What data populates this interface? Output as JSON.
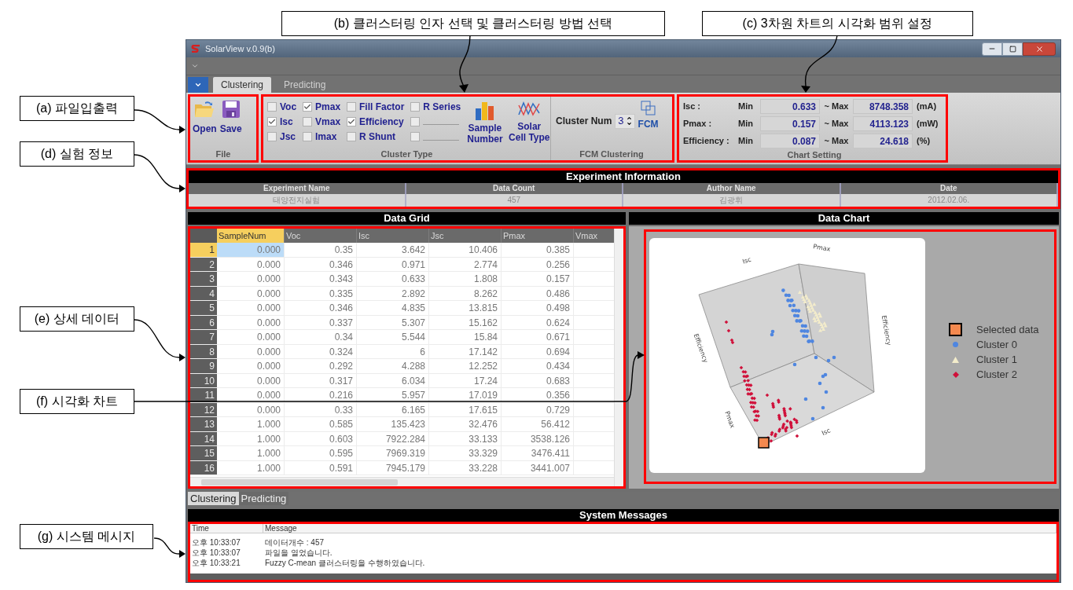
{
  "callouts": [
    {
      "label": "(a) 파일입출력"
    },
    {
      "label": "(d) 실험 정보"
    },
    {
      "label": "(e) 상세 데이터"
    },
    {
      "label": "(f) 시각화 차트"
    },
    {
      "label": "(g) 시스템 메시지"
    },
    {
      "label": "(b) 클러스터링 인자 선택 및 클러스터링 방법 선택"
    },
    {
      "label": "(c) 3차원 차트의 시각화 범위 설정"
    }
  ],
  "window": {
    "title": "SolarView v.0.9(b)"
  },
  "tabs": [
    {
      "label": "Clustering",
      "selected": true
    },
    {
      "label": "Predicting",
      "selected": false
    }
  ],
  "ribbon": {
    "file": {
      "buttons": [
        {
          "label": "Open",
          "kind": "open"
        },
        {
          "label": "Save",
          "kind": "save"
        }
      ],
      "group_label": "File"
    },
    "cluster_type": {
      "checkboxes": [
        {
          "kind": "labeled",
          "label": "Voc",
          "checked": false
        },
        {
          "kind": "labeled",
          "label": "Isc",
          "checked": true
        },
        {
          "kind": "labeled",
          "label": "Jsc",
          "checked": false
        },
        {
          "kind": "labeled",
          "label": "Pmax",
          "checked": true
        },
        {
          "kind": "labeled",
          "label": "Vmax",
          "checked": false
        },
        {
          "kind": "labeled",
          "label": "Imax",
          "checked": false
        },
        {
          "kind": "labeled",
          "label": "Fill Factor",
          "checked": false
        },
        {
          "kind": "labeled",
          "label": "Efficiency",
          "checked": true
        },
        {
          "kind": "labeled",
          "label": "R Shunt",
          "checked": false
        },
        {
          "kind": "labeled",
          "label": "R Series",
          "checked": false
        },
        {
          "kind": "blank",
          "checked": false
        },
        {
          "kind": "blank",
          "checked": false
        }
      ],
      "buttons": [
        {
          "label": "Sample Number",
          "kind": "bars"
        },
        {
          "label": "Solar Cell Type",
          "kind": "lines"
        }
      ],
      "group_label": "Cluster Type"
    },
    "fcm": {
      "label": "Cluster Num",
      "value": "3",
      "button": "FCM",
      "group_label": "FCM Clustering"
    },
    "chart_setting": {
      "rows": [
        {
          "label": "Isc :",
          "min_label": "Min",
          "min": "0.633",
          "max_label": "~ Max",
          "max": "8748.358",
          "unit": "(mA)"
        },
        {
          "label": "Pmax :",
          "min_label": "Min",
          "min": "0.157",
          "max_label": "~ Max",
          "max": "4113.123",
          "unit": "(mW)"
        },
        {
          "label": "Efficiency :",
          "min_label": "Min",
          "min": "0.087",
          "max_label": "~ Max",
          "max": "24.618",
          "unit": "(%)"
        }
      ],
      "group_label": "Chart Setting"
    }
  },
  "experiment": {
    "title": "Experiment Information",
    "columns": [
      "Experiment Name",
      "Data Count",
      "Author Name",
      "Date"
    ],
    "values": [
      "태양전지실험",
      "457",
      "김광휘",
      "2012.02.06."
    ]
  },
  "data_grid": {
    "title": "Data Grid",
    "columns": [
      "SampleNum",
      "Voc",
      "Isc",
      "Jsc",
      "Pmax",
      "Vmax"
    ],
    "rows": [
      {
        "number": "1",
        "selected": true,
        "cells": [
          "0.000",
          "0.35",
          "3.642",
          "10.406",
          "0.385"
        ]
      },
      {
        "number": "2",
        "selected": false,
        "cells": [
          "0.000",
          "0.346",
          "0.971",
          "2.774",
          "0.256"
        ]
      },
      {
        "number": "3",
        "selected": false,
        "cells": [
          "0.000",
          "0.343",
          "0.633",
          "1.808",
          "0.157"
        ]
      },
      {
        "number": "4",
        "selected": false,
        "cells": [
          "0.000",
          "0.335",
          "2.892",
          "8.262",
          "0.486"
        ]
      },
      {
        "number": "5",
        "selected": false,
        "cells": [
          "0.000",
          "0.346",
          "4.835",
          "13.815",
          "0.498"
        ]
      },
      {
        "number": "6",
        "selected": false,
        "cells": [
          "0.000",
          "0.337",
          "5.307",
          "15.162",
          "0.624"
        ]
      },
      {
        "number": "7",
        "selected": false,
        "cells": [
          "0.000",
          "0.34",
          "5.544",
          "15.84",
          "0.671"
        ]
      },
      {
        "number": "8",
        "selected": false,
        "cells": [
          "0.000",
          "0.324",
          "6",
          "17.142",
          "0.694"
        ]
      },
      {
        "number": "9",
        "selected": false,
        "cells": [
          "0.000",
          "0.292",
          "4.288",
          "12.252",
          "0.434"
        ]
      },
      {
        "number": "10",
        "selected": false,
        "cells": [
          "0.000",
          "0.317",
          "6.034",
          "17.24",
          "0.683"
        ]
      },
      {
        "number": "11",
        "selected": false,
        "cells": [
          "0.000",
          "0.216",
          "5.957",
          "17.019",
          "0.356"
        ]
      },
      {
        "number": "12",
        "selected": false,
        "cells": [
          "0.000",
          "0.33",
          "6.165",
          "17.615",
          "0.729"
        ]
      },
      {
        "number": "13",
        "selected": false,
        "cells": [
          "1.000",
          "0.585",
          "135.423",
          "32.476",
          "56.412"
        ]
      },
      {
        "number": "14",
        "selected": false,
        "cells": [
          "1.000",
          "0.603",
          "7922.284",
          "33.133",
          "3538.126"
        ]
      },
      {
        "number": "15",
        "selected": false,
        "cells": [
          "1.000",
          "0.595",
          "7969.319",
          "33.329",
          "3476.411"
        ]
      },
      {
        "number": "16",
        "selected": false,
        "cells": [
          "1.000",
          "0.591",
          "7945.179",
          "33.228",
          "3441.007"
        ]
      }
    ]
  },
  "data_chart": {
    "title": "Data Chart",
    "axis_labels": [
      "Isc",
      "Pmax",
      "Efficiency",
      "Efficiency",
      "Pmax",
      "Isc"
    ],
    "legend": [
      {
        "label": "Selected data",
        "kind": "square",
        "color": "#f4894f"
      },
      {
        "label": "Cluster 0",
        "kind": "circle",
        "color": "#4f86e0"
      },
      {
        "label": "Cluster 1",
        "kind": "triangle",
        "color": "#f3eccb"
      },
      {
        "label": "Cluster 2",
        "kind": "diamond",
        "color": "#d0103a"
      }
    ]
  },
  "bottom_tabs": [
    {
      "label": "Clustering",
      "selected": true
    },
    {
      "label": "Predicting",
      "selected": false
    }
  ],
  "messages": {
    "title": "System Messages",
    "columns": [
      "Time",
      "Message"
    ],
    "rows": [
      {
        "time": "오후 10:33:07",
        "message": "데이터개수 : 457"
      },
      {
        "time": "오후 10:33:07",
        "message": "파일을 열었습니다."
      },
      {
        "time": "오후 10:33:21",
        "message": "Fuzzy C-mean 클러스터링을 수행하였습니다."
      }
    ]
  }
}
